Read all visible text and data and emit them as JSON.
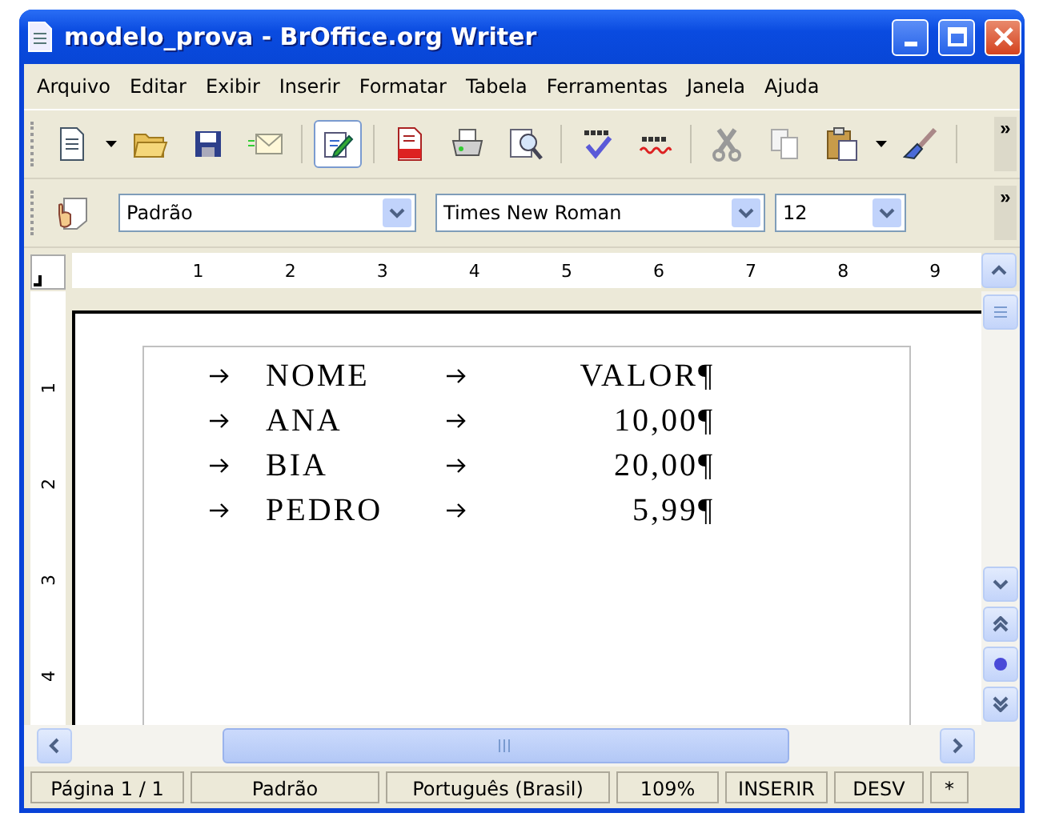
{
  "window": {
    "title": "modelo_prova - BrOffice.org Writer"
  },
  "menu": [
    "Arquivo",
    "Editar",
    "Exibir",
    "Inserir",
    "Formatar",
    "Tabela",
    "Ferramentas",
    "Janela",
    "Ajuda"
  ],
  "toolbar": {
    "edit_mode": {
      "selected": true
    },
    "overflow": "»"
  },
  "format_bar": {
    "style": "Padrão",
    "font": "Times New Roman",
    "size": "12",
    "overflow": "»"
  },
  "ruler": {
    "marks": [
      "1",
      "2",
      "3",
      "4",
      "5",
      "6",
      "7",
      "8",
      "9"
    ]
  },
  "vertical_ruler": {
    "marks": [
      "1",
      "2",
      "3",
      "4"
    ]
  },
  "document": {
    "rows": [
      {
        "name": "NOME",
        "value": "VALOR",
        "end_mark": "¶"
      },
      {
        "name": "ANA",
        "value": "10,00",
        "end_mark": "¶"
      },
      {
        "name": "BIA",
        "value": "20,00",
        "end_mark": "¶"
      },
      {
        "name": "PEDRO",
        "value": "5,99",
        "end_mark": "¶"
      }
    ]
  },
  "status_bar": [
    "Página 1 / 1",
    "Padrão",
    "Português (Brasil)",
    "109%",
    "INSERIR",
    "DESV",
    "*"
  ]
}
